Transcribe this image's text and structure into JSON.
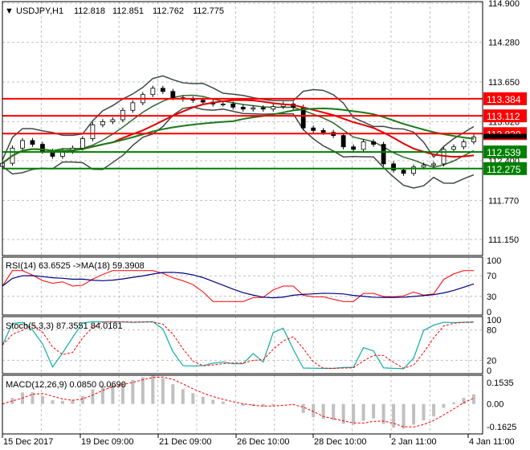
{
  "chart_data": {
    "type": "candlestick",
    "symbol_label": "USDJPY,H1",
    "ohlc_header": [
      "112.818",
      "112.851",
      "112.762",
      "112.775"
    ],
    "ylim": [
      110.95,
      114.95
    ],
    "y_ticks": [
      "114.900",
      "114.280",
      "113.650",
      "113.020",
      "112.400",
      "111.770",
      "111.150"
    ],
    "x_labels": [
      "15 Dec 2017",
      "19 Dec 09:00",
      "21 Dec 09:00",
      "26 Dec 10:00",
      "28 Dec 10:00",
      "2 Jan 11:00",
      "4 Jan 11:00"
    ],
    "close": [
      112.36,
      112.6,
      112.72,
      112.66,
      112.55,
      112.47,
      112.55,
      112.6,
      112.75,
      112.97,
      113.02,
      113.05,
      113.2,
      113.32,
      113.45,
      113.55,
      113.5,
      113.4,
      113.38,
      113.36,
      113.33,
      113.3,
      113.3,
      113.25,
      113.22,
      113.24,
      113.22,
      113.26,
      113.3,
      113.25,
      112.92,
      112.88,
      112.85,
      112.8,
      112.62,
      112.58,
      112.7,
      112.66,
      112.35,
      112.25,
      112.2,
      112.3,
      112.33,
      112.35,
      112.58,
      112.62,
      112.7,
      112.775
    ],
    "levels": [
      {
        "value": 113.384,
        "label": "113.384",
        "color": "#ff0000"
      },
      {
        "value": 113.112,
        "label": "113.112",
        "color": "#ff0000"
      },
      {
        "value": 112.83,
        "label": "112.830",
        "color": "#ff0000"
      },
      {
        "value": 112.539,
        "label": "112.539",
        "color": "#008000"
      },
      {
        "value": 112.275,
        "label": "112.275",
        "color": "#008000"
      }
    ],
    "current_price": {
      "value": 112.775,
      "label": "112.775"
    },
    "rsi": {
      "label": "RSI(14) 63.6525  ->MA(18) 59.3908",
      "ticks": [
        "100",
        "70",
        "30",
        "0"
      ],
      "levels": [
        100,
        70,
        30,
        0
      ]
    },
    "stoch": {
      "label": "Stoch(5,3,3) 87.3551 84.0181",
      "ticks": [
        "100",
        "80",
        "20",
        "0"
      ],
      "levels": [
        100,
        80,
        20,
        0
      ]
    },
    "macd": {
      "label": "MACD(12,26,9) 0.0850 0.0690",
      "ticks": [
        "0.1535",
        "0.00",
        "-0.1625"
      ],
      "levels": [
        0.1535,
        0,
        -0.1625
      ]
    }
  }
}
